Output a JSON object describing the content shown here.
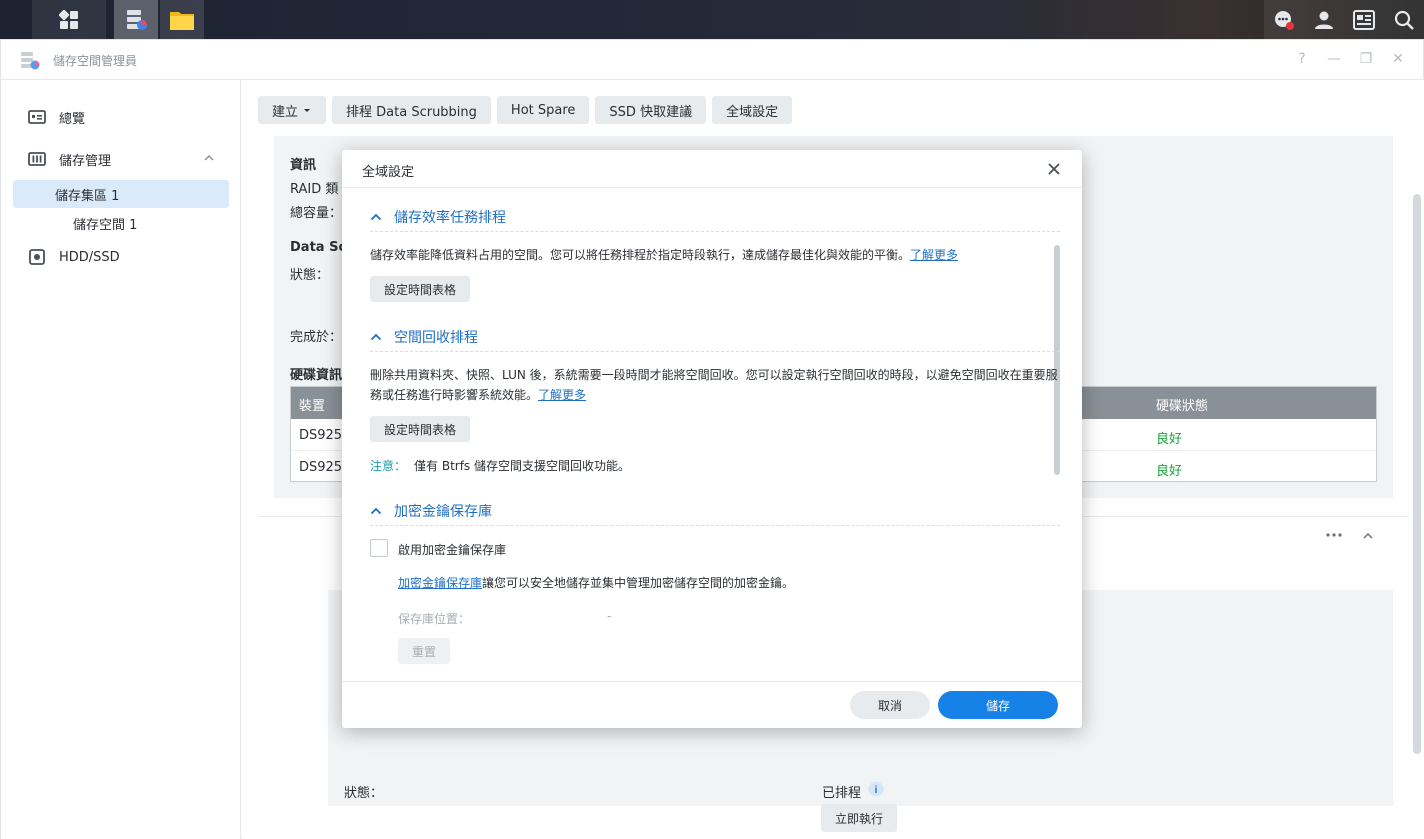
{
  "taskbar": {
    "icons": [
      "apps-grid-icon",
      "storage-manager-icon",
      "file-station-icon"
    ],
    "right_icons": [
      "chat-icon",
      "user-icon",
      "widgets-icon",
      "search-icon"
    ]
  },
  "window": {
    "title": "儲存空間管理員",
    "controls": [
      "help-icon",
      "minimize-icon",
      "restore-icon",
      "close-icon"
    ]
  },
  "sidebar": {
    "items": [
      {
        "label": "總覽",
        "icon": "overview-icon"
      },
      {
        "label": "儲存管理",
        "icon": "storage-icon"
      },
      {
        "label": "儲存集區 1"
      },
      {
        "label": "儲存空間 1"
      },
      {
        "label": "HDD/SSD",
        "icon": "disk-icon"
      }
    ]
  },
  "toolbar": {
    "create": "建立",
    "scrub": "排程 Data Scrubbing",
    "hotspare": "Hot Spare",
    "ssd": "SSD 快取建議",
    "global": "全域設定"
  },
  "panel": {
    "info": "資訊",
    "raid": "RAID 類",
    "capacity": "總容量：",
    "data_scrub": "Data Sc",
    "status": "狀態：",
    "completed": "完成於：",
    "disk_info": "硬碟資訊",
    "table": {
      "col_location": "裝置",
      "col_status": "硬碟狀態",
      "rows": [
        {
          "device": "DS925",
          "status": "良好"
        },
        {
          "device": "DS925",
          "status": "良好"
        }
      ]
    },
    "lower_status": "狀態：",
    "scheduled": "已排程",
    "run_now": "立即執行"
  },
  "dialog": {
    "title": "全域設定",
    "sec1": {
      "title": "儲存效率任務排程",
      "desc": "儲存效率能降低資料占用的空間。您可以將任務排程於指定時段執行，達成儲存最佳化與效能的平衡。",
      "link": "了解更多",
      "button": "設定時間表格"
    },
    "sec2": {
      "title": "空間回收排程",
      "desc": "刪除共用資料夾、快照、LUN 後，系統需要一段時間才能將空間回收。您可以設定執行空間回收的時段，以避免空間回收在重要服務或任務進行時影響系統效能。",
      "link": "了解更多",
      "button": "設定時間表格",
      "note_label": "注意：",
      "note": "僅有 Btrfs 儲存空間支援空間回收功能。"
    },
    "sec3": {
      "title": "加密金鑰保存庫",
      "checkbox": "啟用加密金鑰保存庫",
      "link": "加密金鑰保存庫",
      "desc": "讓您可以安全地儲存並集中管理加密儲存空間的加密金鑰。",
      "location_label": "保存庫位置：",
      "location_value": "-",
      "reset": "重置"
    },
    "cancel": "取消",
    "save": "儲存"
  }
}
